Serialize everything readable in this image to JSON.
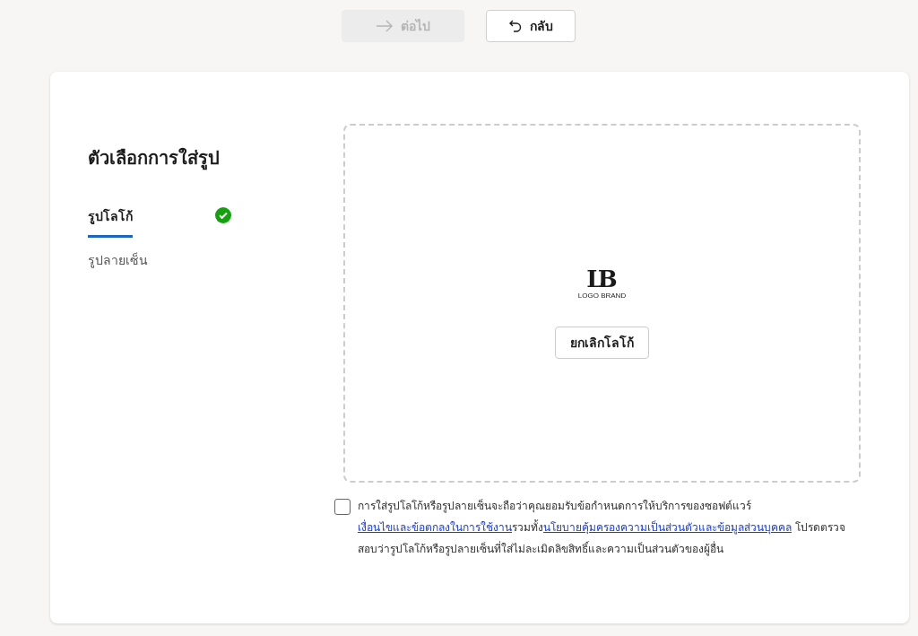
{
  "toolbar": {
    "buttons": [
      {
        "label": "ต่อไป",
        "kind": "next",
        "disabled": true
      },
      {
        "label": "กลับ",
        "kind": "back",
        "disabled": false
      }
    ]
  },
  "panel": {
    "title": "ตัวเลือกการใส่รูป",
    "tabs": [
      {
        "label": "รูปโลโก้",
        "selected": true,
        "done": true
      },
      {
        "label": "รูปลายเซ็น",
        "selected": false,
        "done": false
      }
    ],
    "preview": {
      "logo": {
        "mark": "LB",
        "caption": "LOGO BRAND"
      },
      "remove_button": "ยกเลิกโลโก้"
    },
    "consent": {
      "checked": false,
      "parts": [
        {
          "kind": "text",
          "text": "การใส่รูปโลโก้หรือรูปลายเซ็นจะถือว่าคุณยอมรับข้อกำหนดการให้บริการของซอฟต์แวร์"
        },
        {
          "kind": "link",
          "text": "เงื่อนไขและข้อตกลงในการใช้งาน"
        },
        {
          "kind": "text",
          "text": "รวมทั้ง"
        },
        {
          "kind": "link",
          "text": "นโยบายคุ้มครองความเป็นส่วนตัวและข้อมูลส่วนบุคคล"
        },
        {
          "kind": "text",
          "text": " โปรดตรวจสอบว่ารูปโลโก้หรือรูปลายเซ็นที่ใส่ไม่ละเมิดลิขสิทธิ์และความเป็นส่วนตัวของผู้อื่น"
        }
      ]
    }
  }
}
